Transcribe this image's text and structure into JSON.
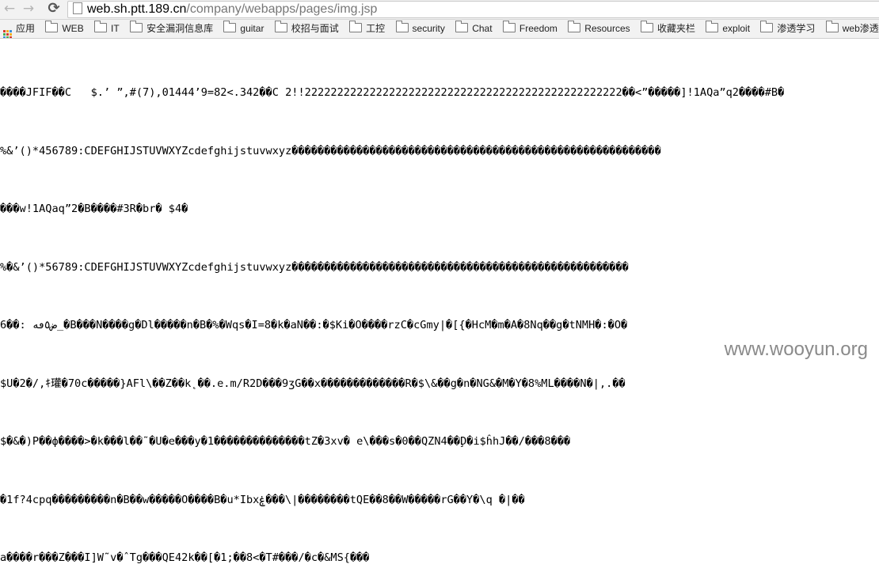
{
  "browser": {
    "nav": {
      "back": "←",
      "forward": "→",
      "reload": "⟳"
    },
    "address_host": "web.sh.ptt.189.cn",
    "address_path": "/company/webapps/pages/img.jsp"
  },
  "bookmarks": {
    "apps_label": "应用",
    "folders": [
      "WEB",
      "IT",
      "安全漏洞信息库",
      "guitar",
      "校招与面试",
      "工控",
      "security",
      "Chat",
      "Freedom",
      "Resources",
      "收藏夹栏",
      "exploit",
      "渗透学习",
      "web渗透"
    ]
  },
  "page_lines": [
    "����JFIF��C   $.’ ”,#(7),01444’9=82<.342��C 2!!2222222222222222222222222222222222222222222222222��<”�����]!1AQa”q2����#B�",
    "%&’()*456789:CDEFGHIJSTUVWXYZcdefghijstuvwxyz���������������������������������������������������������",
    "���w!1AQaq”2�B����#3R�br� $4�",
    "%�&’()*56789:CDEFGHIJSTUVWXYZcdefghijstuvwxyz����������������������������������������������������",
    "6��: ض٥ڡه_�B���N����g�Dl�����n�B�%�Wqs�I=8�k�aN��:�$Ki�O����rzC�cGmy|�[{�HcM�m�A�8Nq��g�tNMH�:�O�",
    "$U�2�/,ｷ瓘�70c�����}AFl\\��Z��k˛��.e.m/R2D���9ʒG��x�������������R�$\\&��g�n�NG&�M�Y�8%ML����N�|,.��",
    "$�&�)P��ф����>�k���l��˜�U�e���y�1��������������tZ�3xv� e\\���s�0��QZN4��Ḑ�i$ĥhJ��/���8���",
    "�1f?4cpq���������n�B��w�����O����B�u*Ibxۼ���\\|��������tQE��8��W�����rG��Y�\\q �|��",
    "a����r���Z���I]W˜v�ˆTg���QE42k��[�1;��8<�T#���/�c�&MS{���"
  ],
  "watermark": "www.wooyun.org"
}
